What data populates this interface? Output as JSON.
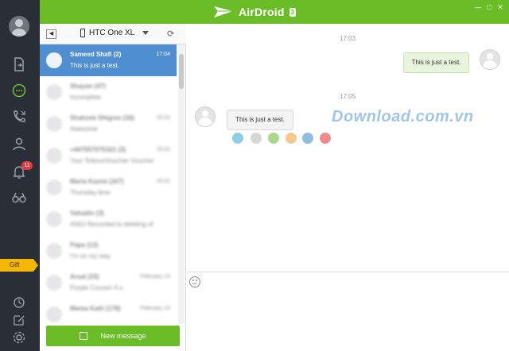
{
  "app": {
    "name": "AirDroid",
    "version": "3"
  },
  "window_controls": {
    "minimize": "—",
    "maximize": "□",
    "close": "✕"
  },
  "rail": {
    "items": [
      "file-transfer",
      "messages",
      "calls",
      "contacts",
      "notifications",
      "binoculars"
    ],
    "notification_count": "11",
    "gift_label": "Gift",
    "bottom_items": [
      "history",
      "edit",
      "settings"
    ]
  },
  "device": {
    "name": "HTC One XL"
  },
  "conversations": [
    {
      "name": "Sameed Shafi  (2)",
      "time": "17:04",
      "preview": "This is just a test.",
      "active": true
    },
    {
      "name": "Shayan (47)",
      "time": "",
      "preview": "Incomplete",
      "active": false
    },
    {
      "name": "Shahzeb Shigree (18)",
      "time": "15:01",
      "preview": "Awesome",
      "active": false
    },
    {
      "name": "+447557075321 (3)",
      "time": "15:01",
      "preview": "Your TelenorVoucher Voucher",
      "active": false
    },
    {
      "name": "Maria Kazmi (167)",
      "time": "15:01",
      "preview": "Thursday time",
      "active": false
    },
    {
      "name": "Vahadin (3)",
      "time": "",
      "preview": "ANGI Recorded to deleting of",
      "active": false
    },
    {
      "name": "Papa (12)",
      "time": "",
      "preview": "I'm on my way",
      "active": false
    },
    {
      "name": "Arsal (33)",
      "time": "February 14",
      "preview": "Purple Cocoon 4 u",
      "active": false
    },
    {
      "name": "Mama Katti (178)",
      "time": "February 14",
      "preview": "",
      "active": false
    }
  ],
  "new_message_label": "New message",
  "chat": {
    "messages": [
      {
        "timestamp": "17:03",
        "text": "This is just a test.",
        "direction": "outgoing"
      },
      {
        "timestamp": "17:05",
        "text": "This is just a test.",
        "direction": "incoming"
      }
    ]
  },
  "watermark": "Download.com.vn",
  "watermark_dot_colors": [
    "#8ecde6",
    "#d6d6d6",
    "#a8d88c",
    "#f7c98a",
    "#8ebde0",
    "#f08c8c"
  ],
  "colors": {
    "accent": "#6bbd28",
    "rail": "#2a2f37",
    "selected": "#4f8ed0",
    "badge": "#e23b3b",
    "gift": "#f5b800"
  }
}
